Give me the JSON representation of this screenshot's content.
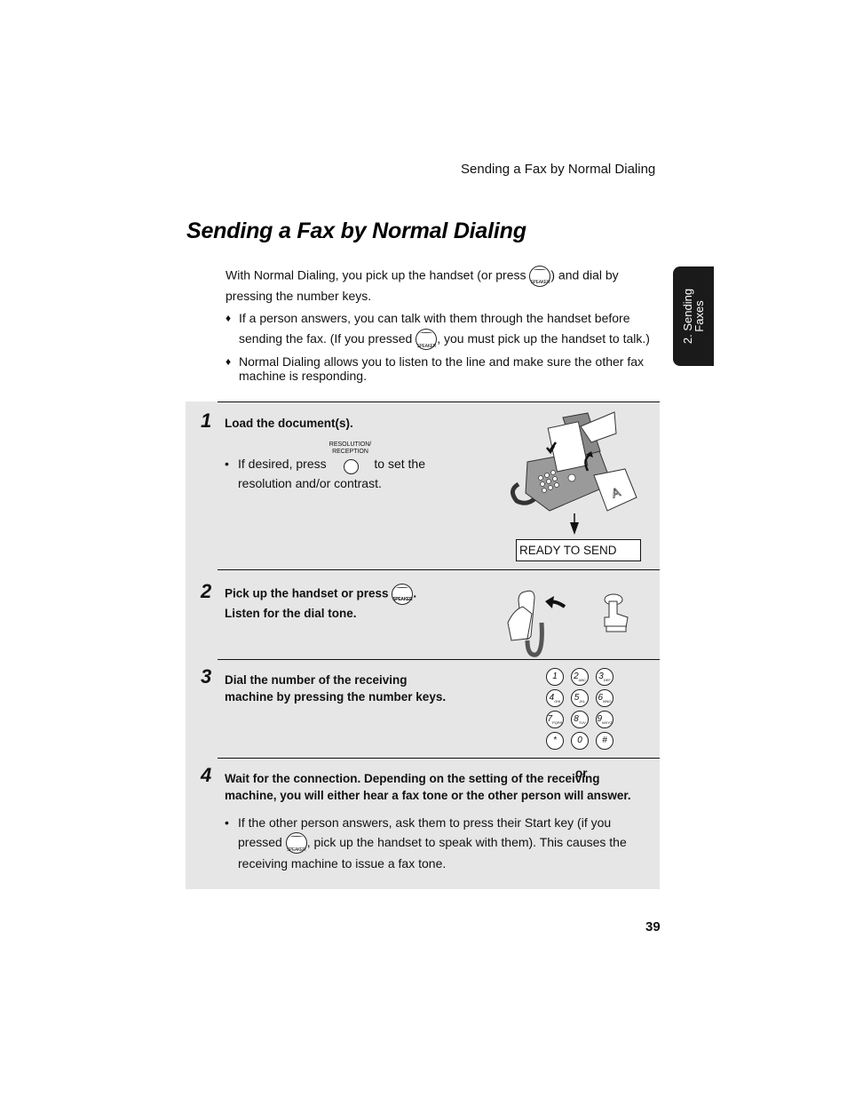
{
  "running_head": "Sending a Fax by Normal Dialing",
  "title": "Sending a Fax by Normal Dialing",
  "intro": {
    "paragraph_before": "With Normal Dialing, you pick up the handset (or press ",
    "paragraph_after": ") and dial by pressing the number keys.",
    "bullets": [
      {
        "before": "If a person answers, you can talk with them through the handset before sending the fax. (If you pressed ",
        "after": ", you must pick up the handset to talk.)"
      },
      {
        "text": "Normal Dialing allows you to listen to the line and make sure the other fax machine is responding."
      }
    ]
  },
  "speaker_button_label": "SPEAKER",
  "side_tab": {
    "line1": "2. Sending",
    "line2": "Faxes"
  },
  "steps": [
    {
      "number": "1",
      "text": "Load the document(s).",
      "sub_before": "If desired, press ",
      "sub_button_label_1": "RESOLUTION/",
      "sub_button_label_2": "RECEPTION",
      "sub_after": " to set the resolution and/or contrast.",
      "display": "READY TO SEND"
    },
    {
      "number": "2",
      "text_before": "Pick up the handset or press ",
      "text_after": ".",
      "text_line2": "Listen for the dial tone.",
      "or_label": "or"
    },
    {
      "number": "3",
      "text_line1": "Dial the number of the receiving",
      "text_line2": "machine by pressing the number keys.",
      "keys": [
        {
          "d": "1",
          "l": ""
        },
        {
          "d": "2",
          "l": "ABC"
        },
        {
          "d": "3",
          "l": "DEF"
        },
        {
          "d": "4",
          "l": "GHI"
        },
        {
          "d": "5",
          "l": "JKL"
        },
        {
          "d": "6",
          "l": "MNO"
        },
        {
          "d": "7",
          "l": "PQRS"
        },
        {
          "d": "8",
          "l": "TUV"
        },
        {
          "d": "9",
          "l": "WXYZ"
        },
        {
          "d": "*",
          "l": ""
        },
        {
          "d": "0",
          "l": ""
        },
        {
          "d": "#",
          "l": ""
        }
      ]
    },
    {
      "number": "4",
      "text_line1": "Wait for the connection. Depending on the setting of the receiving",
      "text_line2": "machine, you will either hear a fax tone or the other person will answer.",
      "sub_before": "If the other person answers, ask them to press their Start key (if you pressed ",
      "sub_after": ", pick up the handset to speak with them). This causes the receiving machine to issue a fax tone."
    }
  ],
  "page_number": "39"
}
